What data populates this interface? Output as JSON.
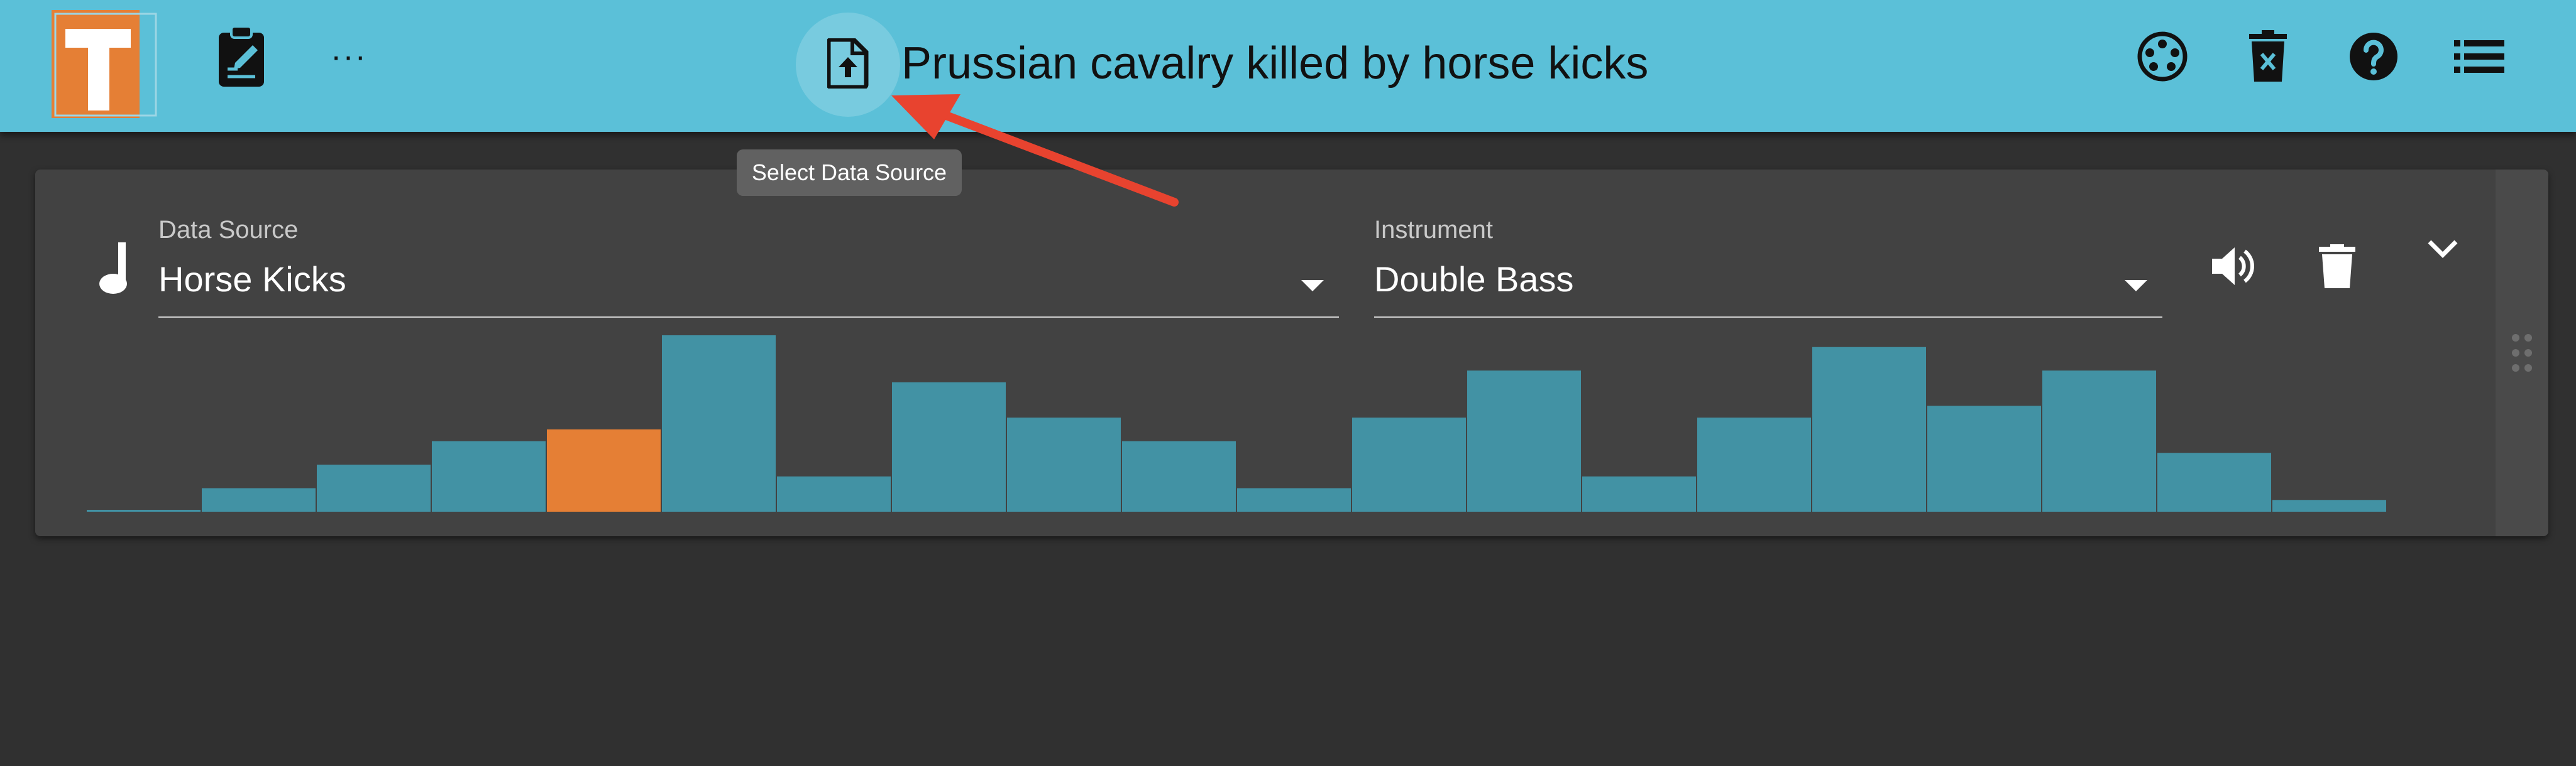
{
  "app": {
    "title": "Prussian cavalry killed by horse kicks",
    "logo_letter": "T",
    "colors": {
      "topbar": "#5bc0d8",
      "background": "#303030",
      "card": "#424242",
      "accent": "#e57f35",
      "bar": "#4292a4"
    }
  },
  "toolbar": {
    "left_icons": [
      "logo-icon",
      "clipboard-edit-icon",
      "more-horizontal-icon"
    ],
    "more_label": "···",
    "right_icons": [
      "midi-port-icon",
      "delete-all-icon",
      "help-icon",
      "list-menu-icon"
    ],
    "upload_icon": "file-upload-icon"
  },
  "tooltip": {
    "text": "Select Data Source"
  },
  "track": {
    "icon": "music-note-icon",
    "data_source": {
      "label": "Data Source",
      "value": "Horse Kicks"
    },
    "instrument": {
      "label": "Instrument",
      "value": "Double Bass"
    },
    "actions": [
      "volume-icon",
      "trash-icon",
      "chevron-down-icon",
      "drag-handle-icon"
    ]
  },
  "chart_data": {
    "type": "bar",
    "title": "",
    "xlabel": "",
    "ylabel": "",
    "values": [
      0,
      2,
      4,
      6,
      7,
      15,
      3,
      11,
      8,
      6,
      2,
      8,
      12,
      3,
      8,
      14,
      9,
      12,
      5,
      1
    ],
    "highlighted_index": 4,
    "highlight_color": "#e57f35",
    "bar_color": "#4292a4",
    "ylim": [
      0,
      15
    ],
    "grid": false,
    "legend": "none"
  }
}
